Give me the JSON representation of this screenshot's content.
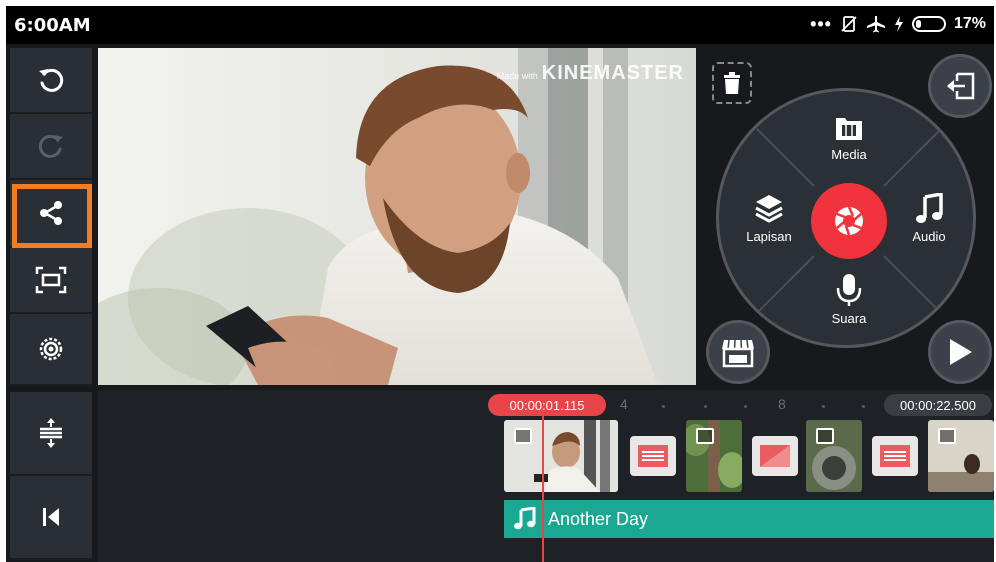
{
  "status_bar": {
    "time": "6:00AM",
    "battery_percent": "17%",
    "icons": [
      "more-dots-icon",
      "no-sim-icon",
      "airplane-icon",
      "charging-icon",
      "battery-icon"
    ]
  },
  "left_toolbar": {
    "items": [
      {
        "name": "undo",
        "icon": "undo-icon",
        "enabled": true
      },
      {
        "name": "redo",
        "icon": "redo-icon",
        "enabled": false
      },
      {
        "name": "share",
        "icon": "share-icon",
        "highlighted": true
      },
      {
        "name": "fullscreen",
        "icon": "fullscreen-icon"
      },
      {
        "name": "settings",
        "icon": "gear-icon"
      },
      {
        "name": "expand-timeline",
        "icon": "expand-vertical-icon"
      },
      {
        "name": "jump-to-start",
        "icon": "skip-to-start-icon"
      }
    ]
  },
  "preview": {
    "watermark_small": "Made with",
    "watermark_brand": "KINEMASTER"
  },
  "media_wheel": {
    "media_label": "Media",
    "layer_label": "Lapisan",
    "audio_label": "Audio",
    "voice_label": "Suara",
    "record_icon": "camera-shutter-icon"
  },
  "timeline": {
    "current_time": "00:00:01.115",
    "total_time": "00:00:22.500",
    "ruler_labels": [
      "4",
      "8"
    ],
    "audio_track_title": "Another Day"
  },
  "colors": {
    "accent_red": "#e74548",
    "highlight_orange": "#f17c22",
    "audio_teal": "#1aa893",
    "panel_bg": "#2a2e35"
  }
}
